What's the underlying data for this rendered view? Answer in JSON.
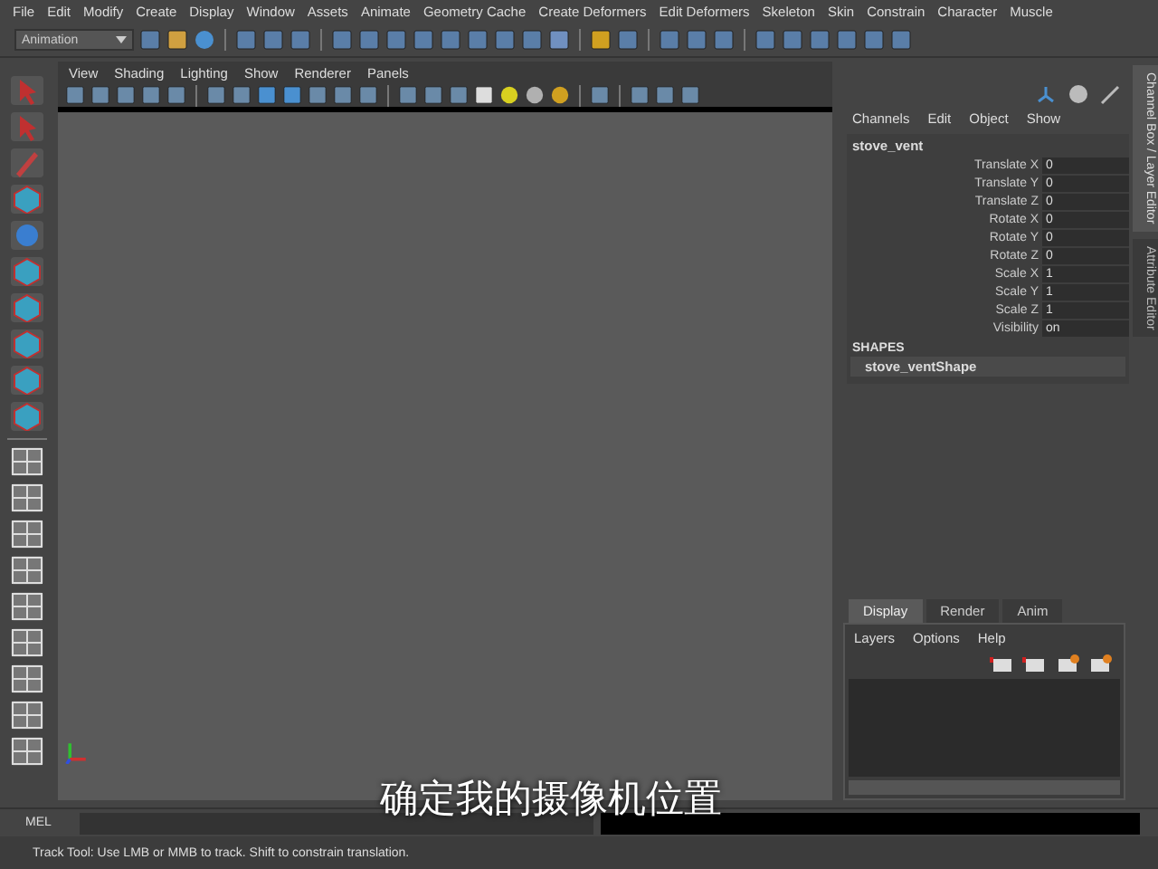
{
  "menu_bar": [
    "File",
    "Edit",
    "Modify",
    "Create",
    "Display",
    "Window",
    "Assets",
    "Animate",
    "Geometry Cache",
    "Create Deformers",
    "Edit Deformers",
    "Skeleton",
    "Skin",
    "Constrain",
    "Character",
    "Muscle"
  ],
  "mode_dropdown": {
    "value": "Animation"
  },
  "viewport": {
    "menu": [
      "View",
      "Shading",
      "Lighting",
      "Show",
      "Renderer",
      "Panels"
    ]
  },
  "channel_box": {
    "menu": [
      "Channels",
      "Edit",
      "Object",
      "Show"
    ],
    "object": "stove_vent",
    "attributes": [
      {
        "name": "Translate X",
        "value": "0"
      },
      {
        "name": "Translate Y",
        "value": "0"
      },
      {
        "name": "Translate Z",
        "value": "0"
      },
      {
        "name": "Rotate X",
        "value": "0"
      },
      {
        "name": "Rotate Y",
        "value": "0"
      },
      {
        "name": "Rotate Z",
        "value": "0"
      },
      {
        "name": "Scale X",
        "value": "1"
      },
      {
        "name": "Scale Y",
        "value": "1"
      },
      {
        "name": "Scale Z",
        "value": "1"
      },
      {
        "name": "Visibility",
        "value": "on"
      }
    ],
    "shapes_heading": "SHAPES",
    "shape": "stove_ventShape"
  },
  "side_tabs": [
    {
      "label": "Channel Box / Layer Editor",
      "selected": true
    },
    {
      "label": "Attribute Editor",
      "selected": false
    }
  ],
  "layer_editor": {
    "tabs": [
      {
        "label": "Display",
        "selected": true
      },
      {
        "label": "Render",
        "selected": false
      },
      {
        "label": "Anim",
        "selected": false
      }
    ],
    "menu": [
      "Layers",
      "Options",
      "Help"
    ]
  },
  "command_line": {
    "label": "MEL"
  },
  "help_line": "Track Tool: Use LMB or MMB to track. Shift to constrain translation.",
  "subtitle": "确定我的摄像机位置"
}
